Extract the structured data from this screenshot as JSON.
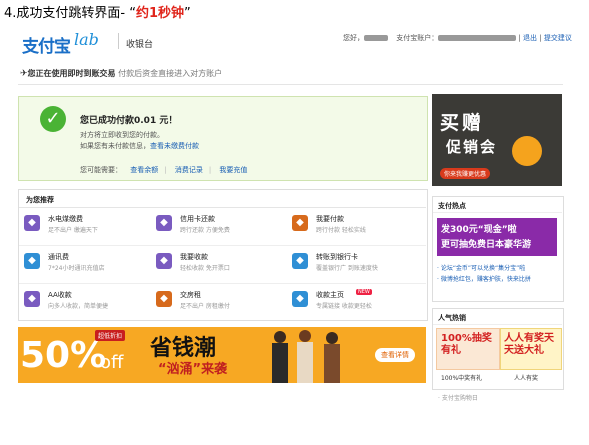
{
  "caption": {
    "prefix": "4.成功支付跳转界面- “",
    "highlight": "约1秒钟",
    "suffix": "”"
  },
  "header": {
    "logo_text": "支付宝",
    "logo_lab": "lab",
    "cashier": "收银台",
    "greeting": "您好，",
    "account_label": "支付宝账户：",
    "logout": "退出",
    "feedback": "提交建议"
  },
  "notice": {
    "bold": "您正在使用即时到账交易",
    "text": "付款后资金直接进入对方账户"
  },
  "success": {
    "amount_text": "您已成功付款0.01 元！",
    "line1": "对方将立即收到您的付款。",
    "line2_prefix": "如果您有未付款信息，",
    "line2_link": "查看未缴费付款",
    "maybe_label": "您可能需要：",
    "links": [
      "查看余额",
      "消费记录",
      "我要充值"
    ]
  },
  "recommend": {
    "title": "为您推荐",
    "services": [
      {
        "name": "水电煤缴费",
        "desc": "足不出户 缴遍天下",
        "icon": "water-icon",
        "color": "#7a5bc0"
      },
      {
        "name": "信用卡还款",
        "desc": "跨行还款 方便免费",
        "icon": "card-icon",
        "color": "#7a5bc0"
      },
      {
        "name": "我要付款",
        "desc": "跨行付款 轻松实线",
        "icon": "pay-icon",
        "color": "#d76a1c"
      },
      {
        "name": "通讯费",
        "desc": "7*24小时通讯充值店",
        "icon": "phone-icon",
        "color": "#2f8fd5"
      },
      {
        "name": "我要收款",
        "desc": "轻松收款 免开票口",
        "icon": "receive-icon",
        "color": "#7a5bc0"
      },
      {
        "name": "转账到银行卡",
        "desc": "覆盖银行广 到账速度快",
        "icon": "bank-icon",
        "color": "#2f8fd5"
      },
      {
        "name": "AA收款",
        "desc": "向多人收款，简单便捷",
        "icon": "aa-icon",
        "color": "#7a5bc0"
      },
      {
        "name": "交房租",
        "desc": "足不出户 房租缴付",
        "icon": "rent-icon",
        "color": "#d76a1c"
      },
      {
        "name": "收款主页",
        "desc": "专属链接 收款更轻松",
        "icon": "homepage-icon",
        "color": "#2f8fd5",
        "tag": "NEW"
      }
    ]
  },
  "banner": {
    "percent": "50%",
    "off": "off",
    "flag": "超低折扣",
    "title": "省钱潮",
    "sub": "“汹涌”来袭",
    "button": "查看详情"
  },
  "ad_top": {
    "title": "买赠",
    "sub": "促销会",
    "button": "你来我赚更优惠"
  },
  "hot": {
    "title": "支付热点",
    "ad_line1": "发300元“现金”啦",
    "ad_line2": "更可抽免费日本豪华游",
    "links": [
      "· 论坛“金币”可以兑换“集分宝”啦",
      "· 微博抢红包，赚客护肤，快来比拼"
    ]
  },
  "popular": {
    "title": "人气热销",
    "a_text": "100%抽奖有礼",
    "b_text": "人人有奖天天送大礼",
    "a_caption": "100%中奖有礼",
    "b_caption": "人人有奖",
    "footer": "· 支付宝购物日"
  }
}
